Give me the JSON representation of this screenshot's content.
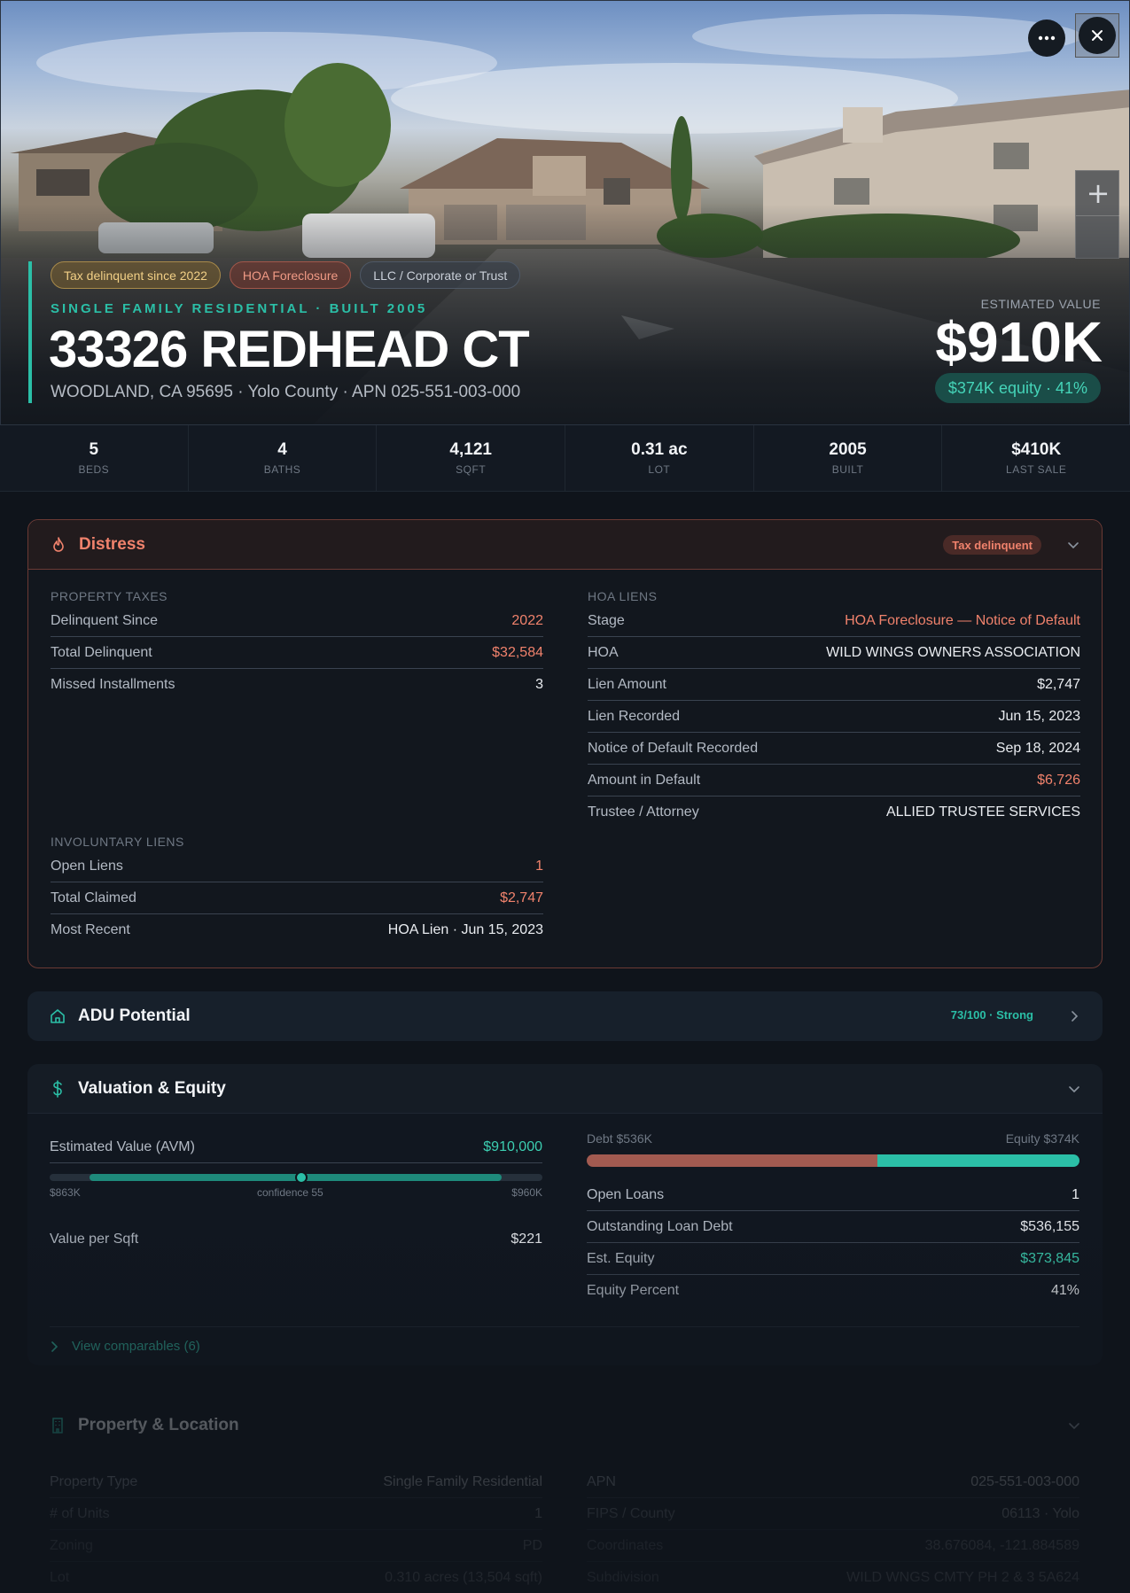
{
  "hero": {
    "badges": [
      "Tax delinquent since 2022",
      "HOA Foreclosure",
      "LLC / Corporate or Trust"
    ],
    "subtitle": "SINGLE FAMILY RESIDENTIAL · BUILT 2005",
    "address": "33326 REDHEAD CT",
    "location": "WOODLAND, CA 95695 · Yolo County · APN 025-551-003-000",
    "estimated_label": "ESTIMATED VALUE",
    "estimated_value": "$910K",
    "equity": "$374K equity · 41%",
    "zoom_plus": "+"
  },
  "stats": [
    {
      "value": "5",
      "label": "BEDS"
    },
    {
      "value": "4",
      "label": "BATHS"
    },
    {
      "value": "4,121",
      "label": "SQFT"
    },
    {
      "value": "0.31 ac",
      "label": "LOT"
    },
    {
      "value": "2005",
      "label": "BUILT"
    },
    {
      "value": "$410K",
      "label": "LAST SALE"
    }
  ],
  "distress": {
    "title": "Distress",
    "pill": "Tax delinquent",
    "taxes": {
      "label": "PROPERTY TAXES",
      "rows": [
        {
          "k": "Delinquent Since",
          "v": "2022"
        },
        {
          "k": "Total Delinquent",
          "v": "$32,584"
        },
        {
          "k": "Missed Installments",
          "v": "3"
        }
      ]
    },
    "hoa": {
      "label": "HOA LIENS",
      "rows": [
        {
          "k": "Stage",
          "v": "HOA Foreclosure — Notice of Default"
        },
        {
          "k": "HOA",
          "v": "WILD WINGS OWNERS ASSOCIATION"
        },
        {
          "k": "Lien Amount",
          "v": "$2,747"
        },
        {
          "k": "Lien Recorded",
          "v": "Jun 15, 2023"
        },
        {
          "k": "Notice of Default Recorded",
          "v": "Sep 18, 2024"
        },
        {
          "k": "Amount in Default",
          "v": "$6,726"
        },
        {
          "k": "Trustee / Attorney",
          "v": "ALLIED TRUSTEE SERVICES"
        }
      ]
    },
    "liens": {
      "label": "INVOLUNTARY LIENS",
      "rows": [
        {
          "k": "Open Liens",
          "v": "1"
        },
        {
          "k": "Total Claimed",
          "v": "$2,747"
        },
        {
          "k": "Most Recent",
          "v": "HOA Lien · Jun 15, 2023"
        }
      ]
    }
  },
  "adu": {
    "title": "ADU Potential",
    "score": "73/100 · Strong"
  },
  "valuation": {
    "title": "Valuation & Equity",
    "avm": {
      "k": "Estimated Value (AVM)",
      "v": "$910,000"
    },
    "range": {
      "low": "$863K",
      "mid": "confidence 55",
      "high": "$960K"
    },
    "per_sqft": {
      "k": "Value per Sqft",
      "v": "$221"
    },
    "debt_label": "Debt $536K",
    "equity_label": "Equity $374K",
    "debt_share": 0.59,
    "rows": [
      {
        "k": "Open Loans",
        "v": "1"
      },
      {
        "k": "Outstanding Loan Debt",
        "v": "$536,155"
      },
      {
        "k": "Est. Equity",
        "v": "$373,845"
      },
      {
        "k": "Equity Percent",
        "v": "41%"
      }
    ],
    "comps": "View comparables (6)"
  },
  "property": {
    "title": "Property & Location",
    "left": [
      {
        "k": "Property Type",
        "v": "Single Family Residential"
      },
      {
        "k": "# of Units",
        "v": "1"
      },
      {
        "k": "Zoning",
        "v": "PD"
      },
      {
        "k": "Lot",
        "v": "0.310 acres (13,504 sqft)"
      }
    ],
    "right": [
      {
        "k": "APN",
        "v": "025-551-003-000"
      },
      {
        "k": "FIPS / County",
        "v": "06113 · Yolo"
      },
      {
        "k": "Coordinates",
        "v": "38.676084, -121.884589"
      },
      {
        "k": "Subdivision",
        "v": "WILD WNGS CMTY PH 2 & 3 5A624"
      }
    ]
  },
  "colors": {
    "accent": "#2bbfa7",
    "danger": "#f0826c",
    "background": "#0f141b"
  }
}
